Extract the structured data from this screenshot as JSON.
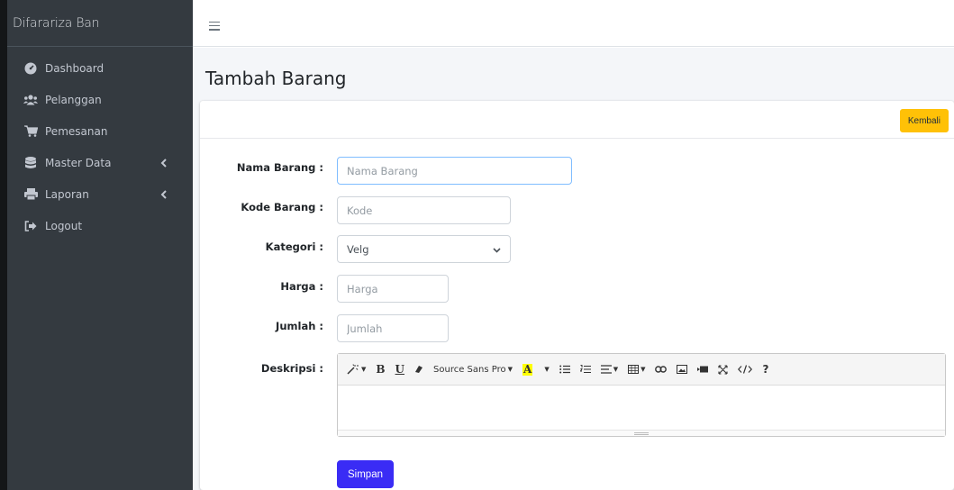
{
  "brand": "Difarariza Ban",
  "sidebar": {
    "items": [
      {
        "label": "Dashboard",
        "icon": "tachometer-icon"
      },
      {
        "label": "Pelanggan",
        "icon": "users-icon"
      },
      {
        "label": "Pemesanan",
        "icon": "shopping-cart-icon"
      },
      {
        "label": "Master Data",
        "icon": "database-icon",
        "has_children": true
      },
      {
        "label": "Laporan",
        "icon": "print-icon",
        "has_children": true
      },
      {
        "label": "Logout",
        "icon": "sign-out-icon"
      }
    ]
  },
  "page": {
    "title": "Tambah Barang"
  },
  "card": {
    "back_label": "Kembali"
  },
  "form": {
    "nama_label": "Nama Barang :",
    "nama_placeholder": "Nama Barang",
    "kode_label": "Kode Barang :",
    "kode_placeholder": "Kode",
    "kategori_label": "Kategori :",
    "kategori_value": "Velg",
    "harga_label": "Harga :",
    "harga_placeholder": "Harga",
    "jumlah_label": "Jumlah :",
    "jumlah_placeholder": "Jumlah",
    "deskripsi_label": "Deskripsi :",
    "submit_label": "Simpan"
  },
  "editor": {
    "font_name": "Source Sans Pro",
    "text_color_label": "A",
    "help_label": "?"
  },
  "colors": {
    "sidebar_bg": "#343a40",
    "primary": "#3a2cf5",
    "warning": "#ffc107",
    "content_bg": "#f4f6f9"
  }
}
